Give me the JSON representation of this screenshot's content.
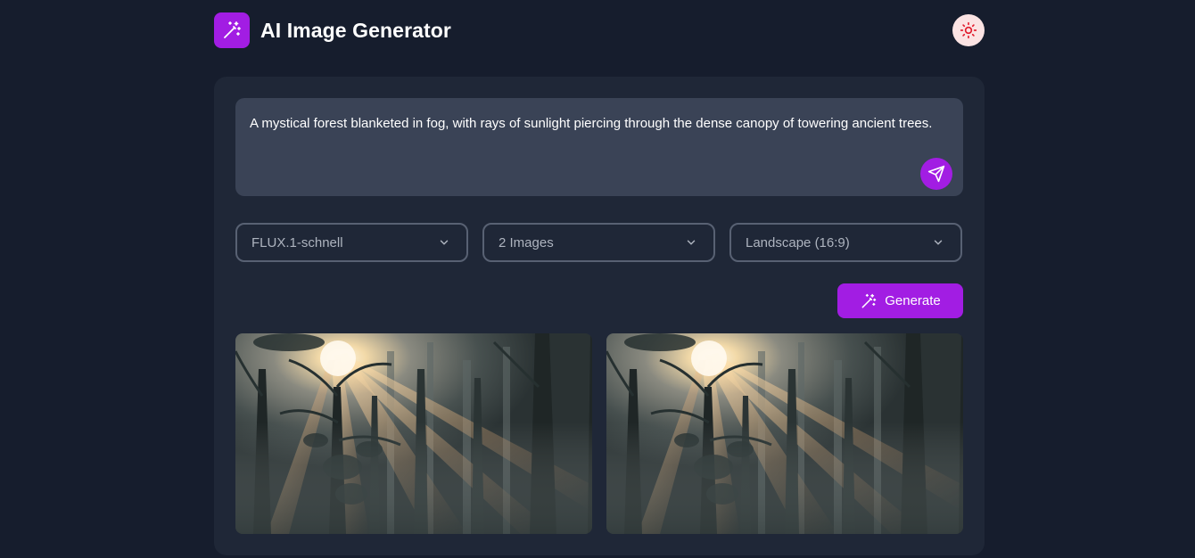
{
  "header": {
    "title": "AI Image Generator",
    "logo_icon": "magic-wand-icon",
    "theme_icon": "sun-icon"
  },
  "prompt": {
    "text": "A mystical forest blanketed in fog, with rays of sunlight piercing through the dense canopy of towering ancient trees.",
    "send_icon": "send-icon"
  },
  "options": {
    "model": "FLUX.1-schnell",
    "count": "2 Images",
    "ratio": "Landscape (16:9)"
  },
  "generate": {
    "label": "Generate",
    "icon": "magic-wand-icon"
  },
  "results": [
    {
      "subject": "misty forest with sun rays"
    },
    {
      "subject": "misty forest with sun rays"
    }
  ],
  "colors": {
    "background": "#161d2d",
    "card": "#1f2737",
    "accent": "#a21de3",
    "input": "#3a4356"
  }
}
